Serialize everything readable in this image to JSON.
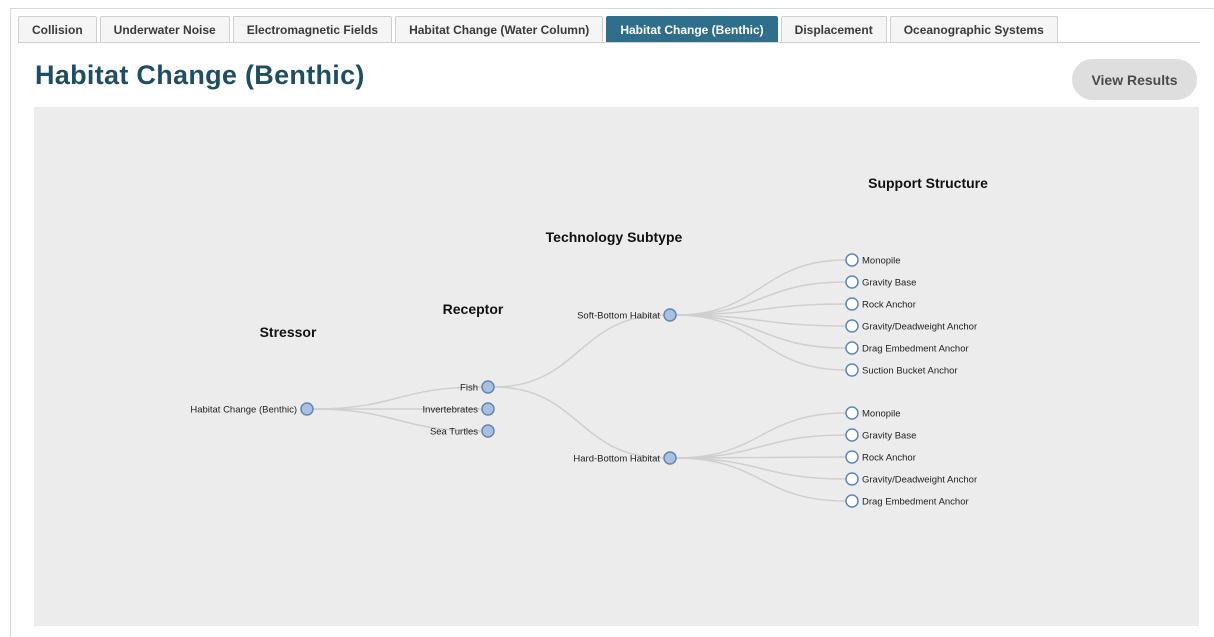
{
  "tabs": [
    {
      "label": "Collision",
      "active": false
    },
    {
      "label": "Underwater Noise",
      "active": false
    },
    {
      "label": "Electromagnetic Fields",
      "active": false
    },
    {
      "label": "Habitat Change (Water Column)",
      "active": false
    },
    {
      "label": "Habitat Change (Benthic)",
      "active": true
    },
    {
      "label": "Displacement",
      "active": false
    },
    {
      "label": "Oceanographic Systems",
      "active": false
    }
  ],
  "page_title": "Habitat Change (Benthic)",
  "view_results_label": "View Results",
  "tree": {
    "column_headers": {
      "stressor": "Stressor",
      "receptor": "Receptor",
      "technology_subtype": "Technology Subtype",
      "support_structure": "Support Structure"
    },
    "stressor": {
      "label": "Habitat Change (Benthic)"
    },
    "receptors": [
      {
        "label": "Fish",
        "expanded": true
      },
      {
        "label": "Invertebrates",
        "expanded": false
      },
      {
        "label": "Sea Turtles",
        "expanded": false
      }
    ],
    "subtypes": [
      {
        "label": "Soft-Bottom Habitat",
        "structures": [
          "Monopile",
          "Gravity Base",
          "Rock Anchor",
          "Gravity/Deadweight Anchor",
          "Drag Embedment Anchor",
          "Suction Bucket Anchor"
        ]
      },
      {
        "label": "Hard-Bottom Habitat",
        "structures": [
          "Monopile",
          "Gravity Base",
          "Rock Anchor",
          "Gravity/Deadweight Anchor",
          "Drag Embedment Anchor"
        ]
      }
    ]
  },
  "colors": {
    "accent": "#2f6f8b",
    "title": "#1f4e63",
    "node_fill": "#aac0dc",
    "node_stroke": "#5d87b8",
    "link": "#cfcfcf",
    "panel": "#ececec"
  }
}
